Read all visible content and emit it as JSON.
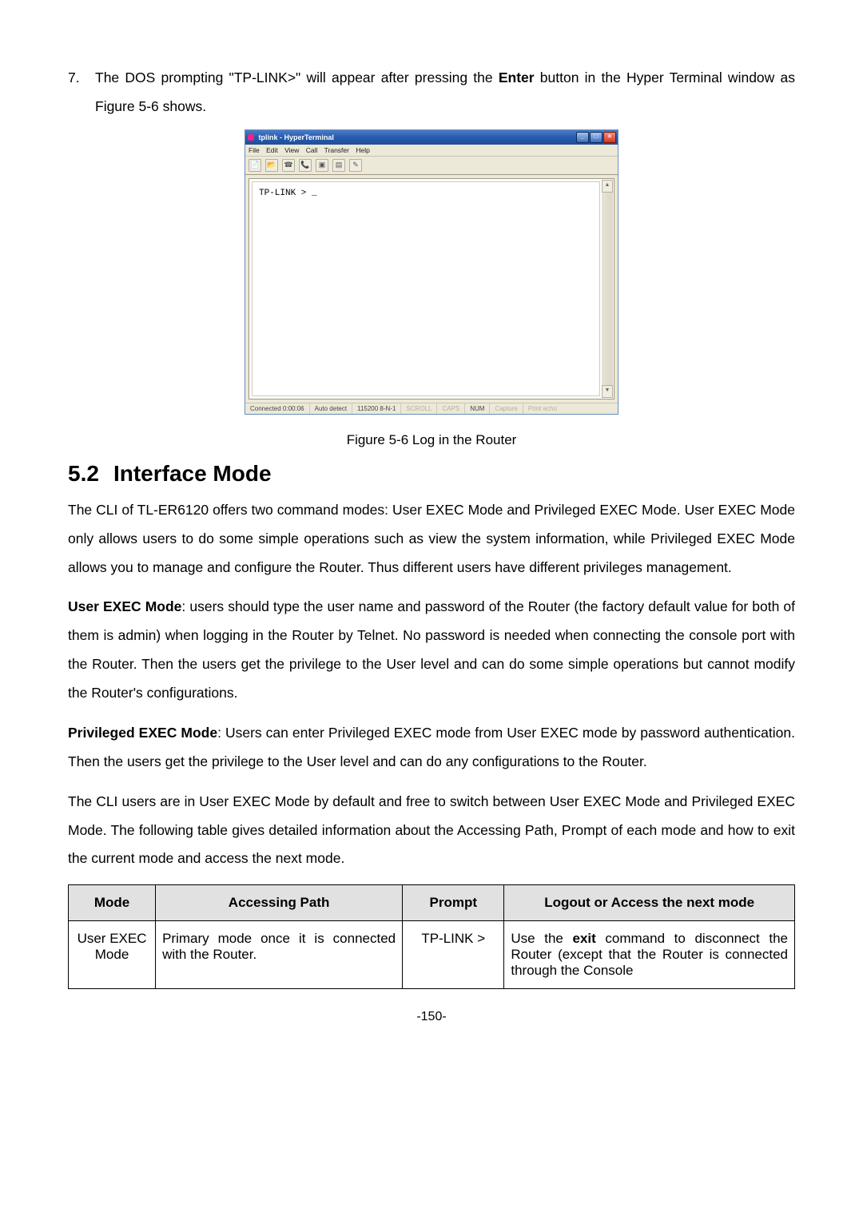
{
  "listItem": {
    "number": "7.",
    "text_a": "The DOS prompting \"TP-LINK>\" will appear after pressing the ",
    "text_enter": "Enter",
    "text_b": " button in the Hyper Terminal window as Figure 5-6 shows."
  },
  "hyperterm": {
    "title": "tplink - HyperTerminal",
    "menus": [
      "File",
      "Edit",
      "View",
      "Call",
      "Transfer",
      "Help"
    ],
    "toolbar_icons": [
      "new-icon",
      "open-icon",
      "phone-icon",
      "call-icon",
      "disc-icon",
      "send-icon",
      "props-icon"
    ],
    "prompt": "TP-LINK > _",
    "status": {
      "connected": "Connected 0:00:06",
      "detect": "Auto detect",
      "baud": "115200 8-N-1",
      "scroll": "SCROLL",
      "caps": "CAPS",
      "num": "NUM",
      "capture": "Capture",
      "printecho": "Print echo"
    }
  },
  "caption": "Figure 5-6 Log in the Router",
  "section": {
    "num": "5.2",
    "title": "Interface Mode"
  },
  "p1": "The CLI of TL-ER6120 offers two command modes: User EXEC Mode and Privileged EXEC Mode. User EXEC Mode only allows users to do some simple operations such as view the system information, while Privileged EXEC Mode allows you to manage and configure the Router. Thus different users have different privileges management.",
  "p2_lead": "User EXEC Mode",
  "p2_body": ": users should type the user name and password of the Router (the factory default value for both of them is admin) when logging in the Router by Telnet. No password is needed when connecting the console port with the Router. Then the users get the privilege to the User level and can do some simple operations but cannot modify the Router's configurations.",
  "p3_lead": "Privileged EXEC Mode",
  "p3_body": ": Users can enter Privileged EXEC mode from User EXEC mode by password authentication. Then the users get the privilege to the User level and can do any configurations to the Router.",
  "p4": "The CLI users are in User EXEC Mode by default and free to switch between User EXEC Mode and Privileged EXEC Mode. The following table gives detailed information about the Accessing Path, Prompt of each mode and how to exit the current mode and access the next mode.",
  "table": {
    "headers": {
      "mode": "Mode",
      "path": "Accessing Path",
      "prompt": "Prompt",
      "logout": "Logout or Access the next mode"
    },
    "row1": {
      "mode": "User EXEC Mode",
      "path": "Primary mode once it is connected with the Router.",
      "prompt": "TP-LINK >",
      "logout_a": "Use the ",
      "logout_exit": "exit",
      "logout_b": " command to disconnect the Router (except that the Router is connected through the Console"
    }
  },
  "pageNumber": "-150-"
}
